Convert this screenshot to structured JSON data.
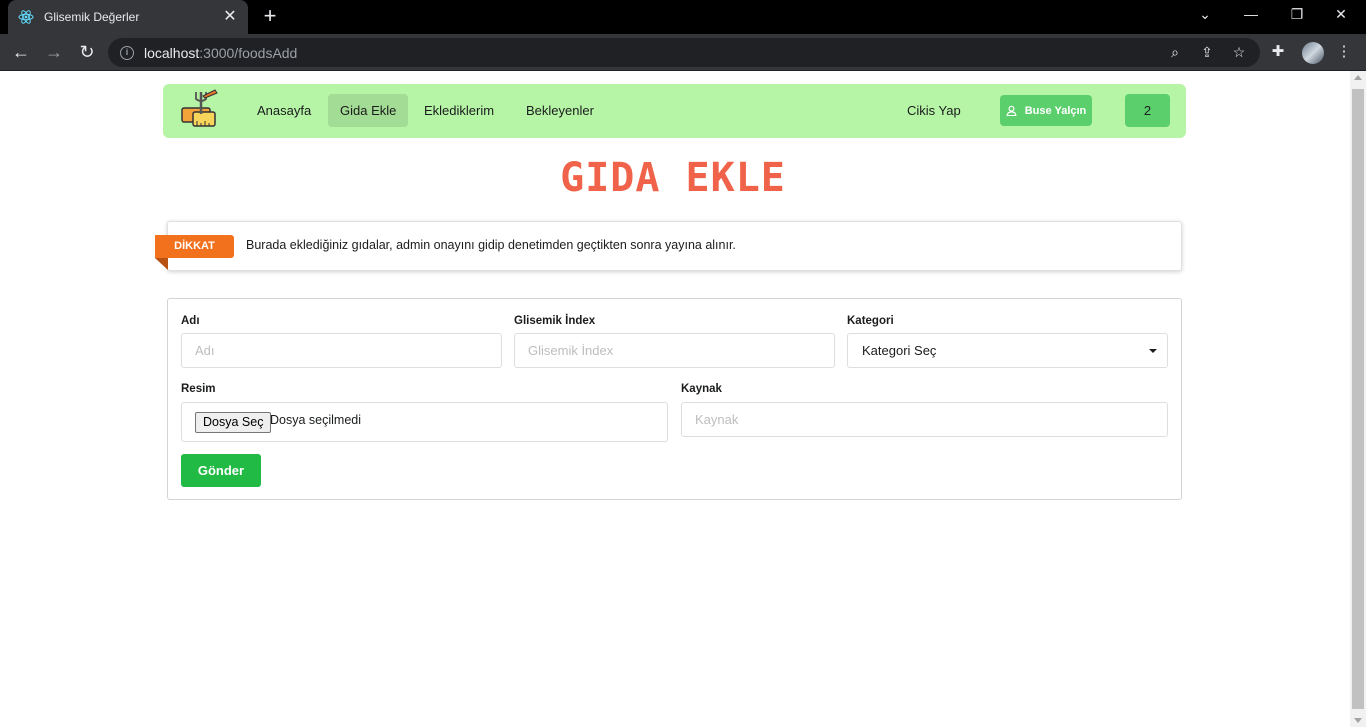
{
  "browser": {
    "tab_title": "Glisemik Değerler",
    "url_host": "localhost",
    "url_path": ":3000/foodsAdd"
  },
  "navbar": {
    "links": [
      "Anasayfa",
      "Gida Ekle",
      "Eklediklerim",
      "Bekleyenler"
    ],
    "active_link": "Gida Ekle",
    "logout": "Cikis Yap",
    "user_name": "Buse Yalçın",
    "count": "2"
  },
  "page": {
    "title": "GIDA EKLE"
  },
  "notice": {
    "badge": "DİKKAT",
    "text": "Burada eklediğiniz gıdalar, admin onayını gidip denetimden geçtikten sonra yayına alınır."
  },
  "form": {
    "name_label": "Adı",
    "name_placeholder": "Adı",
    "gi_label": "Glisemik İndex",
    "gi_placeholder": "Glisemik İndex",
    "category_label": "Kategori",
    "category_selected": "Kategori Seç",
    "image_label": "Resim",
    "file_button": "Dosya Seç",
    "file_status": "Dosya seçilmedi",
    "source_label": "Kaynak",
    "source_placeholder": "Kaynak",
    "submit": "Gönder"
  },
  "colors": {
    "navbar_bg": "#b6f5a6",
    "accent_green": "#5ccf6d",
    "title_red": "#f0634a",
    "ribbon_orange": "#f2711c",
    "submit_green": "#21ba45"
  }
}
